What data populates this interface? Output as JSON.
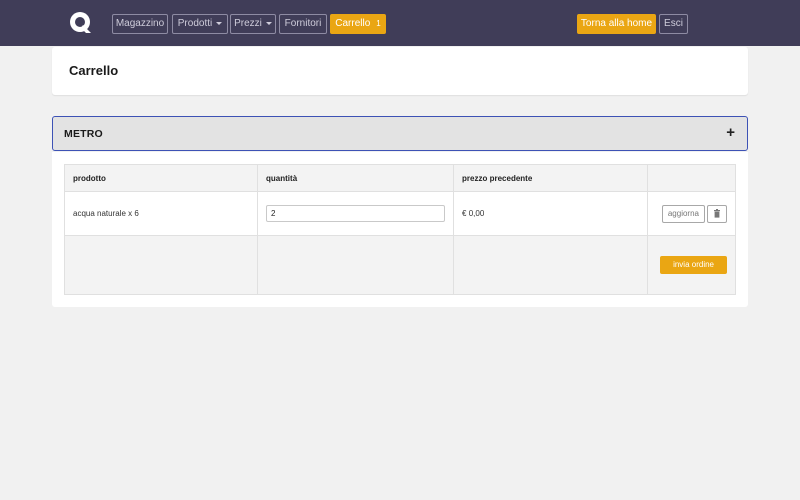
{
  "navbar": {
    "logo_icon": "q-logo-icon",
    "items": [
      {
        "label": "Magazzino",
        "dropdown": false
      },
      {
        "label": "Prodotti",
        "dropdown": true
      },
      {
        "label": "Prezzi",
        "dropdown": true
      },
      {
        "label": "Fornitori",
        "dropdown": false
      }
    ],
    "cart": {
      "label": "Carrello",
      "count": "1"
    },
    "home_label": "Torna alla home",
    "logout_label": "Esci"
  },
  "page": {
    "title": "Carrello"
  },
  "section": {
    "title": "METRO",
    "toggle_icon": "plus-icon"
  },
  "table": {
    "headers": [
      "prodotto",
      "quantità",
      "prezzo precedente",
      ""
    ],
    "rows": [
      {
        "product": "acqua naturale x 6",
        "quantity": "2",
        "previous_price": "€ 0,00"
      }
    ],
    "update_label": "aggiorna",
    "delete_icon": "trash-icon",
    "submit_label": "invia ordine"
  },
  "colors": {
    "navbar_bg": "#403d58",
    "accent": "#eaa613",
    "section_border": "#3d52b5"
  }
}
